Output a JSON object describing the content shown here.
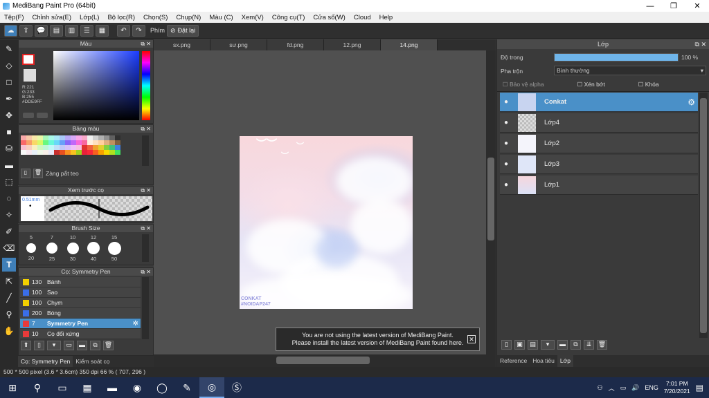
{
  "titlebar": {
    "title": "MediBang Paint Pro (64bit)",
    "minimize": "—",
    "restore": "❐",
    "close": "✕"
  },
  "menu": [
    "Tệp(F)",
    "Chỉnh sửa(E)",
    "Lớp(L)",
    "Bộ lọc(R)",
    "Chọn(S)",
    "Chụp(N)",
    "Màu (C)",
    "Xem(V)",
    "Công cụ(T)",
    "Cửa sổ(W)",
    "Cloud",
    "Help"
  ],
  "toolbar": {
    "shortcut_label": "Phím",
    "reset_label": "Đặt lại"
  },
  "color_panel": {
    "title": "Màu",
    "r": "R:221",
    "g": "G:233",
    "b": "B:255",
    "hex": "#DDE9FF"
  },
  "palette_panel": {
    "title": "Bảng màu",
    "palette_name": "Zàng pắt teo"
  },
  "preview_panel": {
    "title": "Xem trước cọ",
    "size": "0.51mm"
  },
  "brushsize_panel": {
    "title": "Brush Size",
    "sizes_top": [
      "5",
      "7",
      "10",
      "12",
      "15"
    ],
    "sizes_bottom": [
      "20",
      "25",
      "30",
      "40",
      "50"
    ]
  },
  "brush_panel": {
    "title": "Cọ: Symmetry Pen",
    "items": [
      {
        "size": "130",
        "name": "Bánh",
        "color": "#f2d000"
      },
      {
        "size": "100",
        "name": "Sao",
        "color": "#3a6ee8"
      },
      {
        "size": "100",
        "name": "Chym",
        "color": "#f2d000"
      },
      {
        "size": "200",
        "name": "Bóng",
        "color": "#3a6ee8"
      },
      {
        "size": "7",
        "name": "Symmetry Pen",
        "color": "#e83a3a"
      },
      {
        "size": "10",
        "name": "Cọ đổi xứng",
        "color": "#e83a3a"
      }
    ]
  },
  "bottom_tabs": {
    "tab1": "Cọ: Symmetry Pen",
    "tab2": "Kiểm soát cọ"
  },
  "doc_tabs": [
    "sx.png",
    "sư.png",
    "fd.png",
    "12.png",
    "14.png"
  ],
  "canvas": {
    "signature_line1": "CONKAT",
    "signature_line2": "#NOIDAP247"
  },
  "toast": {
    "line1": "You are not using the latest version of MediBang Paint.",
    "line2": "Please install the latest version of MediBang Paint found here.",
    "close": "✕"
  },
  "layers_panel": {
    "title": "Lớp",
    "opacity_label": "Độ trong",
    "opacity_value": "100 %",
    "opacity": 1.0,
    "blend_label": "Pha trộn",
    "blend_value": "Bình thường",
    "protect_alpha": "Bảo vệ alpha",
    "clip": "Xén bớt",
    "lock": "Khóa",
    "layers": [
      "Conkat",
      "Lớp4",
      "Lớp2",
      "Lớp3",
      "Lớp1"
    ],
    "tabs": [
      "Reference",
      "Hoa tiêu",
      "Lớp"
    ]
  },
  "status": {
    "text": "500 * 500 pixel  (3.6 * 3.6cm)  350 dpi  66 %  ( 707, 296 )"
  },
  "taskbar": {
    "lang": "ENG",
    "time": "7:01 PM",
    "date": "7/20/2021"
  }
}
